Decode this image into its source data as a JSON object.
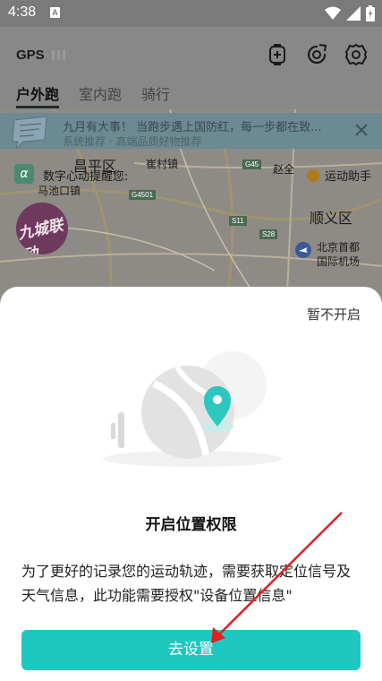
{
  "status_bar": {
    "time": "4:38",
    "badge": "A",
    "icons": [
      "wifi-icon",
      "cell-signal-icon",
      "battery-icon"
    ]
  },
  "header": {
    "gps_label": "GPS",
    "tabs": [
      {
        "label": "户外跑",
        "active": true
      },
      {
        "label": "室内跑",
        "active": false
      },
      {
        "label": "骑行",
        "active": false
      }
    ],
    "actions": [
      "watch-add-icon",
      "target-refresh-icon",
      "settings-icon"
    ]
  },
  "banner": {
    "line1": "九月有大事！ 当跑步遇上国防红，每一步都在致...",
    "line2": "系统推荐 · 高端品质好物推荐"
  },
  "map": {
    "heart_label": "数字心动提醒您:",
    "assistant_label": "运动助手",
    "logo_text": "九城联动",
    "places": [
      "昌平区",
      "崔村镇",
      "赵全",
      "马池口镇",
      "顺义区",
      "北京首都",
      "国际机场"
    ],
    "roads": [
      "G45",
      "G4501",
      "S11",
      "S28"
    ]
  },
  "dialog": {
    "skip_label": "暂不开启",
    "title": "开启位置权限",
    "description": "为了更好的记录您的运动轨迹，需要获取定位信号及天气信息，此功能需要授权\"设备位置信息\"",
    "button_label": "去设置"
  },
  "colors": {
    "accent": "#1ec8c0",
    "arrow": "#e02020"
  }
}
